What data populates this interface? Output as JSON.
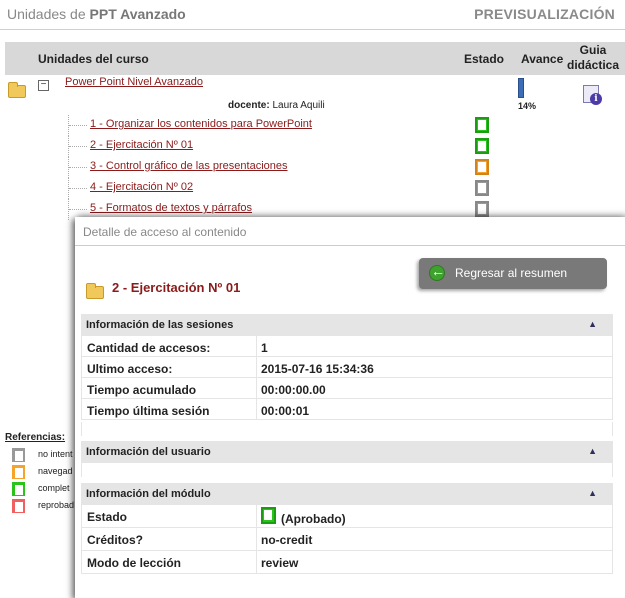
{
  "header": {
    "title_prefix": "Unidades de",
    "title_course": "PPT Avanzado",
    "preview_label": "PREVISUALIZACIÓN"
  },
  "table": {
    "col_units": "Unidades del curso",
    "col_status": "Estado",
    "col_progress": "Avance",
    "col_guide": "Guia didáctica"
  },
  "course": {
    "name": "Power Point Nivel Avanzado",
    "teacher_label": "docente:",
    "teacher_name": "Laura Aquili",
    "progress_text": "14%",
    "progress": 0.14,
    "guide_icon": "info-document-icon"
  },
  "units": [
    {
      "label": "1 - Organizar los contenidos para PowerPoint",
      "status": "completed",
      "color": "#28c31b"
    },
    {
      "label": "2 - Ejercitación Nº 01",
      "status": "completed",
      "color": "#28c31b"
    },
    {
      "label": "3 - Control gráfico de las presentaciones",
      "status": "browsed",
      "color": "#f5a32a"
    },
    {
      "label": "4 - Ejercitación Nº 02",
      "status": "not-attempted",
      "color": "#999999"
    },
    {
      "label": "5 - Formatos de textos y párrafos",
      "status": "not-attempted",
      "color": "#999999"
    }
  ],
  "references": {
    "title": "Referencias:",
    "items": [
      {
        "label": "no intent",
        "color": "#999999"
      },
      {
        "label": "navegad",
        "color": "#f5a32a"
      },
      {
        "label": "complet",
        "color": "#28c31b"
      },
      {
        "label": "reprobad",
        "color": "#f06060"
      }
    ]
  },
  "modal": {
    "title": "Detalle de acceso al contenido",
    "back_button": "Regresar al resumen",
    "item_title": "2 - Ejercitación Nº 01",
    "sessions": {
      "header": "Información de las sesiones",
      "rows": [
        {
          "key": "Cantidad de accesos:",
          "value": "1"
        },
        {
          "key": "Ultimo acceso:",
          "value": "2015-07-16 15:34:36"
        },
        {
          "key": "Tiempo acumulado",
          "value": "00:00:00.00"
        },
        {
          "key": "Tiempo última sesión",
          "value": "00:00:01"
        }
      ]
    },
    "user": {
      "header": "Información del usuario"
    },
    "module": {
      "header": "Información del módulo",
      "rows": [
        {
          "key": "Estado",
          "value": "(Aprobado)"
        },
        {
          "key": "Créditos?",
          "value": "no-credit"
        },
        {
          "key": "Modo de lección",
          "value": "review"
        }
      ]
    },
    "collapse_icon": "▲"
  }
}
